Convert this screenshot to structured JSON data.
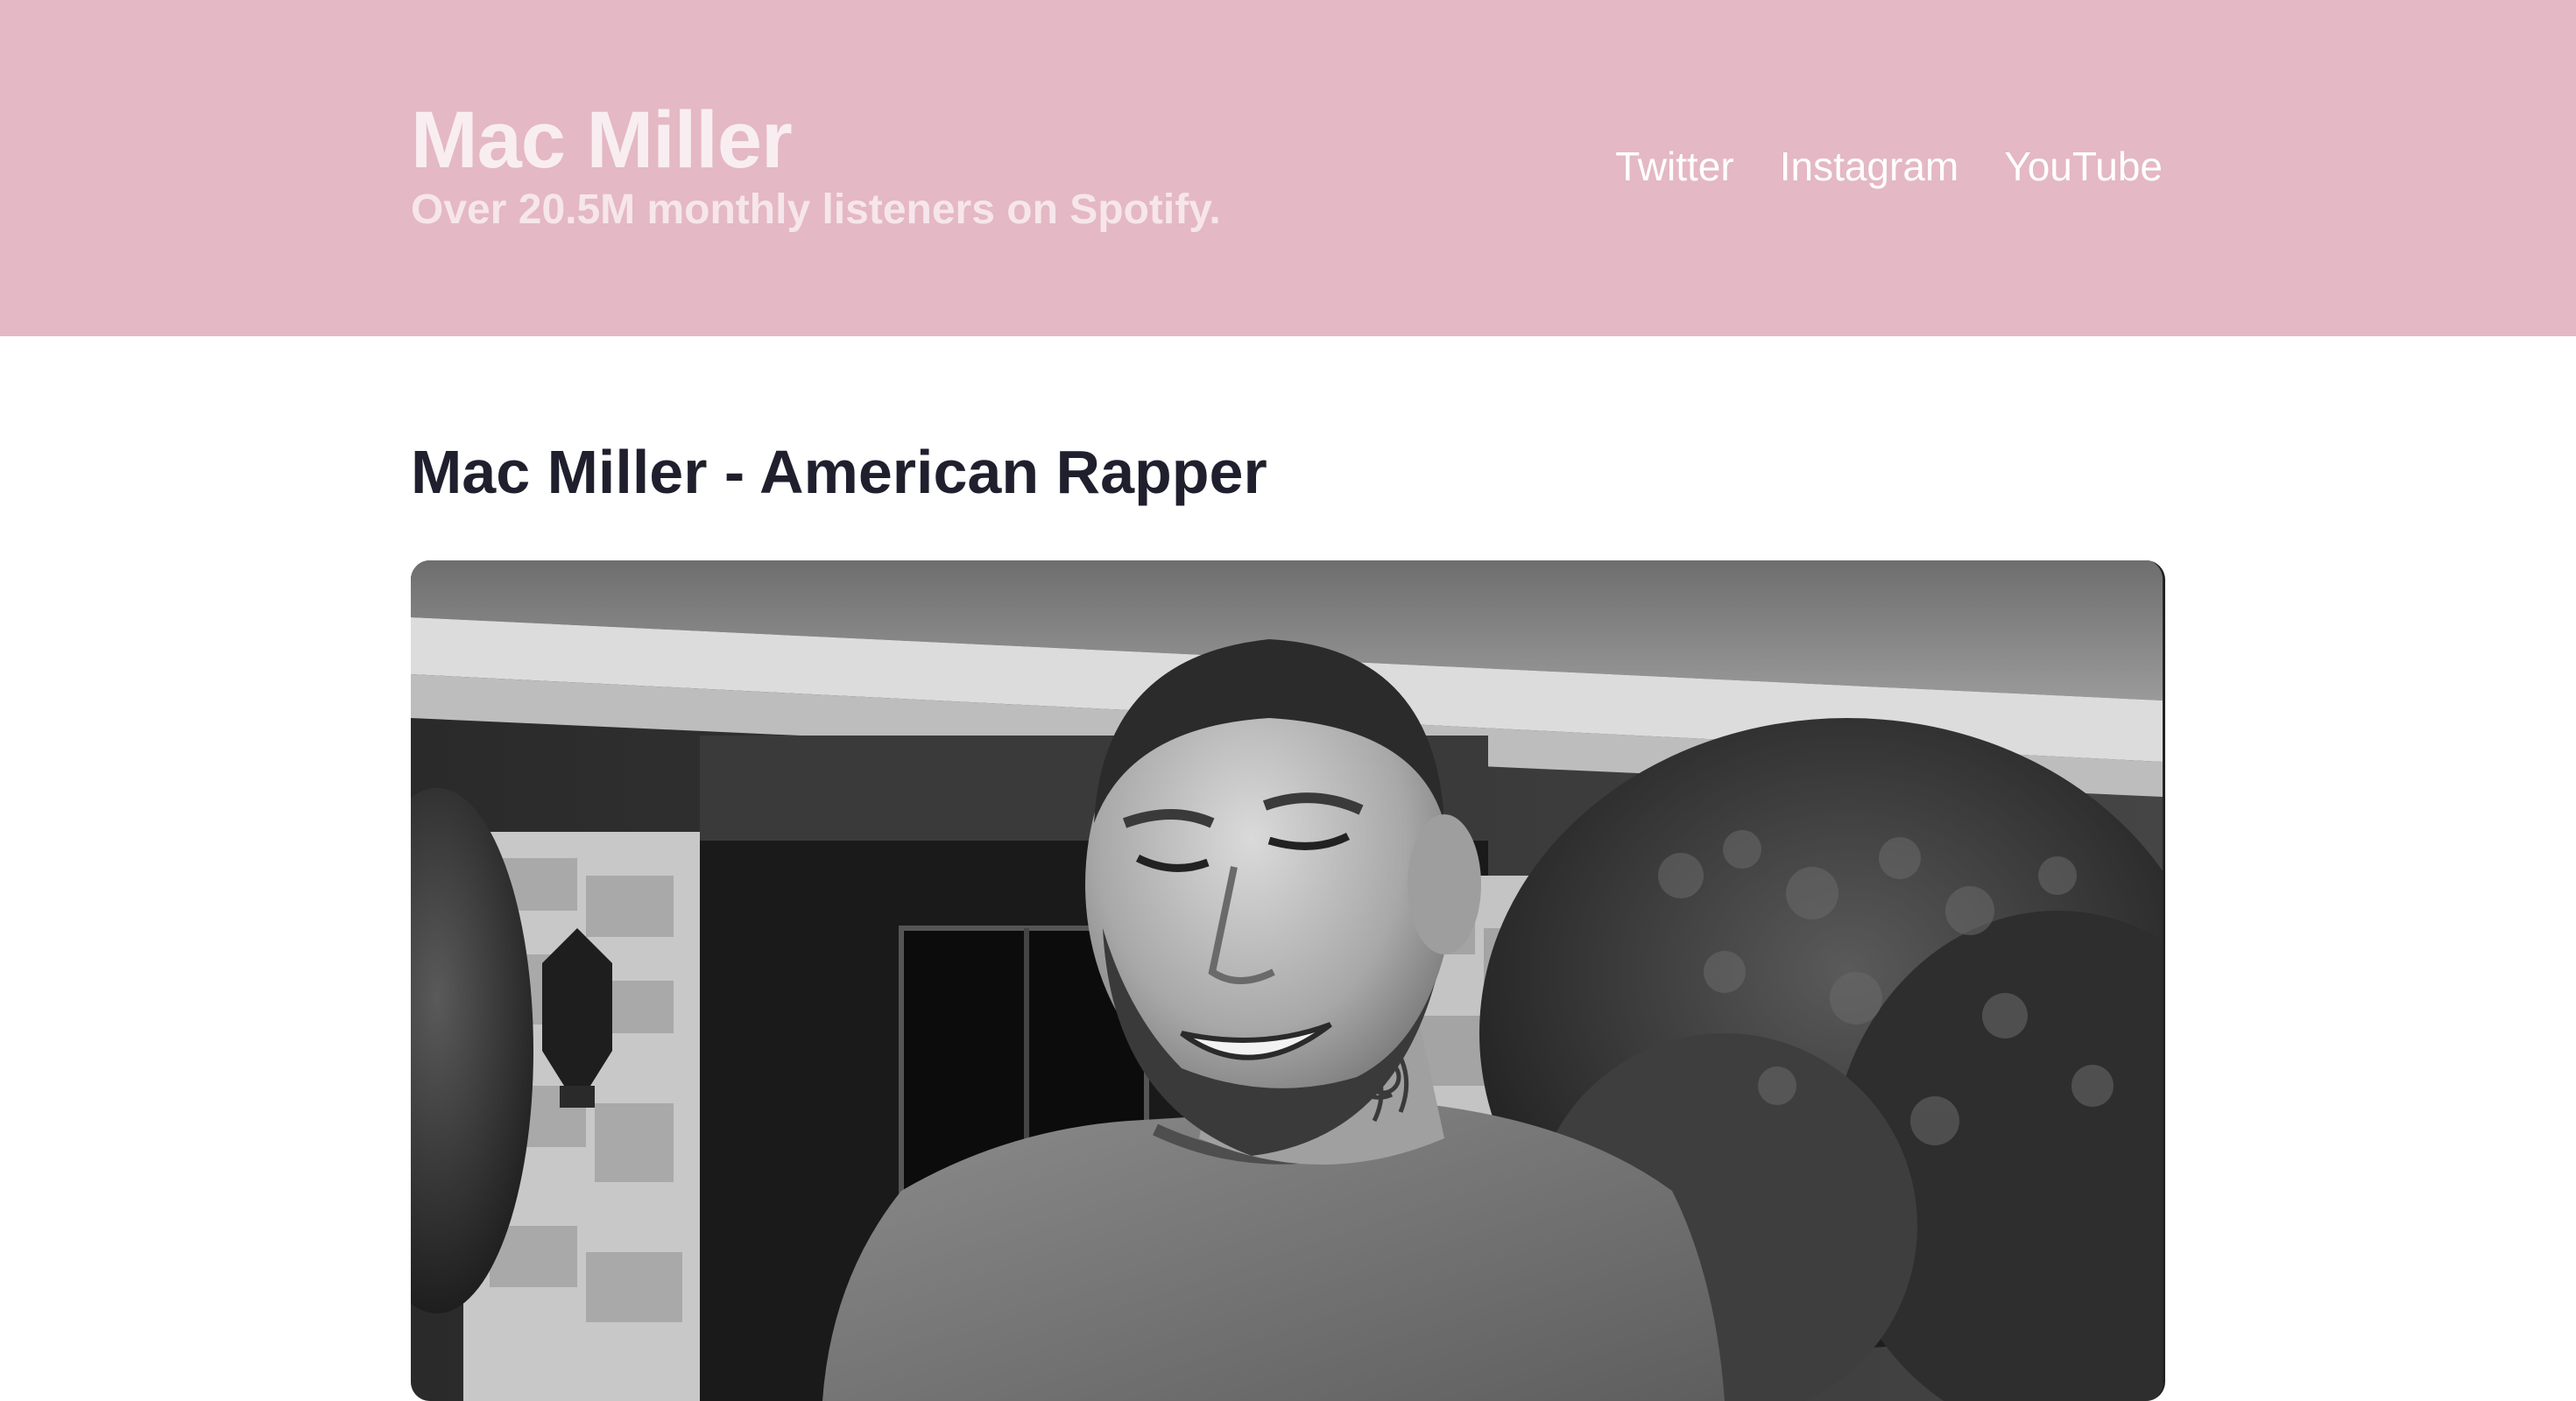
{
  "header": {
    "title": "Mac Miller",
    "tagline": "Over 20.5M monthly listeners on Spotify.",
    "nav": [
      {
        "label": "Twitter"
      },
      {
        "label": "Instagram"
      },
      {
        "label": "YouTube"
      }
    ]
  },
  "main": {
    "heading": "Mac Miller - American Rapper"
  },
  "colors": {
    "header_bg": "#e4b8c4",
    "heading_text": "#1f1f2e"
  }
}
